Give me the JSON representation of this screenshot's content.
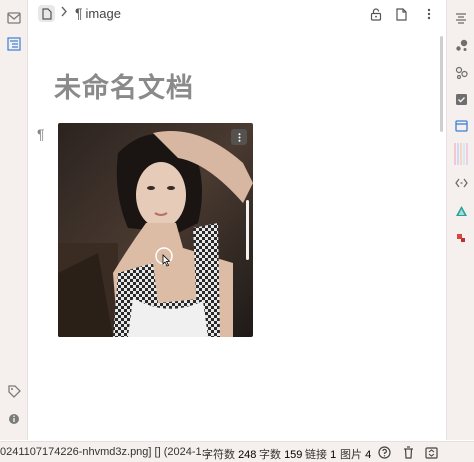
{
  "toolbar": {
    "breadcrumb_label": "image",
    "breadcrumb_icon": "paragraph-icon",
    "icons": [
      "file-icon",
      "chevron-right-icon",
      "lock-icon",
      "document-icon",
      "more-vertical-icon"
    ]
  },
  "document": {
    "title": "未命名文档",
    "block_marker": "¶",
    "image_alt": "portrait photo of a woman in a white and gingham top"
  },
  "left_dock": {
    "icons": [
      "inbox-icon",
      "outline-icon",
      "tag-icon",
      "info-icon"
    ]
  },
  "right_dock": {
    "icons": [
      "align-icon",
      "graph-icon",
      "relation-icon",
      "task-icon",
      "files-icon",
      "color-strip-icon",
      "code-icon",
      "warning-triangle-icon",
      "plugin-icon",
      "link-icon"
    ]
  },
  "status_bar": {
    "file_text": "0241107174226-nhvmd3z.png] [] (2024-1...",
    "char_label": "字符数",
    "char_count": "248",
    "word_label": "字数",
    "word_count": "159",
    "link_label": "链接",
    "link_count": "1",
    "image_label": "图片",
    "image_count": "4"
  },
  "colors": {
    "dock_bg": "#f5f0ed",
    "title_color": "#8a8a8a",
    "accent_blue": "#3b7fd6",
    "accent_red": "#d9443f",
    "accent_teal": "#2aa198"
  }
}
